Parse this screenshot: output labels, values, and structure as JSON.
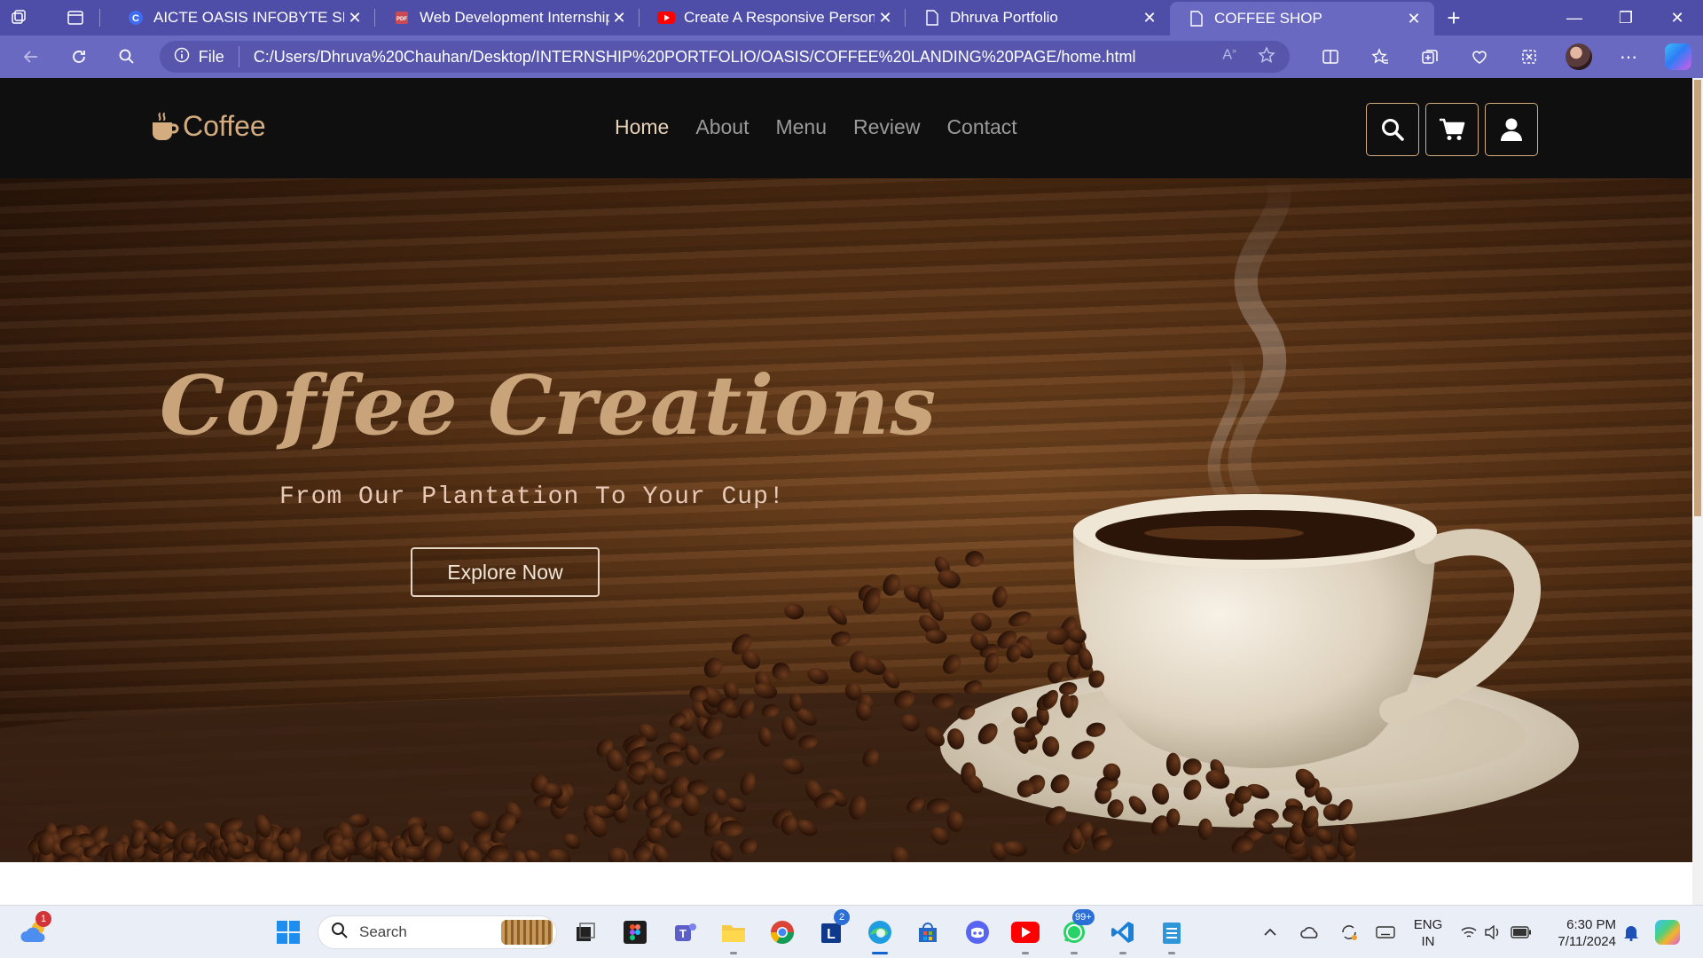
{
  "browser": {
    "tabs": [
      {
        "title": "AICTE OASIS INFOBYTE SIP TASK",
        "favicon": "c-favicon",
        "active": false
      },
      {
        "title": "Web Development Internship Tas",
        "favicon": "pdf-favicon",
        "active": false
      },
      {
        "title": "Create A Responsive Personal PC",
        "favicon": "youtube-favicon",
        "active": false
      },
      {
        "title": "Dhruva Portfolio",
        "favicon": "page-favicon",
        "active": false
      },
      {
        "title": "COFFEE SHOP",
        "favicon": "page-favicon",
        "active": true
      }
    ],
    "address": {
      "scheme_label": "File",
      "url": "C:/Users/Dhruva%20Chauhan/Desktop/INTERNSHIP%20PORTFOLIO/OASIS/COFFEE%20LANDING%20PAGE/home.html"
    },
    "colors": {
      "tabstrip": "#4e4da8",
      "toolbar": "#6a69c2"
    }
  },
  "page": {
    "logo": {
      "text": "Coffee",
      "icon": "coffee-cup-icon"
    },
    "nav": [
      {
        "label": "Home",
        "active": true
      },
      {
        "label": "About",
        "active": false
      },
      {
        "label": "Menu",
        "active": false
      },
      {
        "label": "Review",
        "active": false
      },
      {
        "label": "Contact",
        "active": false
      }
    ],
    "icons": [
      "search-icon",
      "cart-icon",
      "user-icon"
    ],
    "hero": {
      "title": "Coffee Creations",
      "subtitle": "From Our Plantation To Your Cup!",
      "button": "Explore Now"
    },
    "colors": {
      "accent": "#d3ad7f",
      "navbar": "#0f0f0f"
    }
  },
  "taskbar": {
    "search_placeholder": "Search",
    "weather_badge": "1",
    "outlook_badge": "2",
    "whatsapp_badge": "99+",
    "language": {
      "line1": "ENG",
      "line2": "IN"
    },
    "clock": {
      "time": "6:30 PM",
      "date": "7/11/2024"
    }
  }
}
